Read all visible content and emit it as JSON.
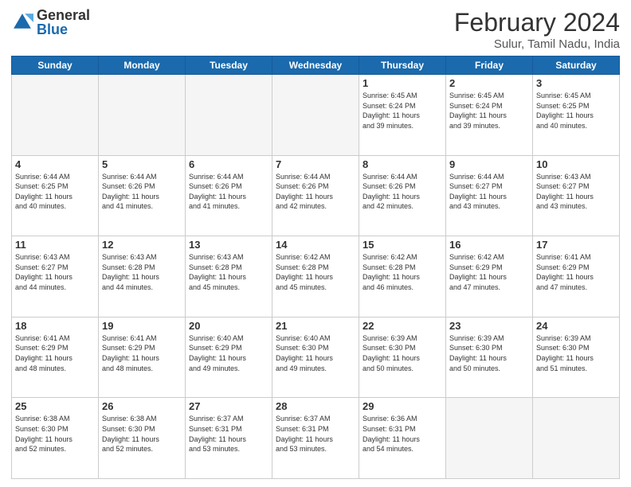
{
  "logo": {
    "general": "General",
    "blue": "Blue"
  },
  "header": {
    "month_year": "February 2024",
    "location": "Sulur, Tamil Nadu, India"
  },
  "days_of_week": [
    "Sunday",
    "Monday",
    "Tuesday",
    "Wednesday",
    "Thursday",
    "Friday",
    "Saturday"
  ],
  "weeks": [
    [
      {
        "day": "",
        "info": "",
        "empty": true
      },
      {
        "day": "",
        "info": "",
        "empty": true
      },
      {
        "day": "",
        "info": "",
        "empty": true
      },
      {
        "day": "",
        "info": "",
        "empty": true
      },
      {
        "day": "1",
        "info": "Sunrise: 6:45 AM\nSunset: 6:24 PM\nDaylight: 11 hours\nand 39 minutes.",
        "empty": false
      },
      {
        "day": "2",
        "info": "Sunrise: 6:45 AM\nSunset: 6:24 PM\nDaylight: 11 hours\nand 39 minutes.",
        "empty": false
      },
      {
        "day": "3",
        "info": "Sunrise: 6:45 AM\nSunset: 6:25 PM\nDaylight: 11 hours\nand 40 minutes.",
        "empty": false
      }
    ],
    [
      {
        "day": "4",
        "info": "Sunrise: 6:44 AM\nSunset: 6:25 PM\nDaylight: 11 hours\nand 40 minutes.",
        "empty": false
      },
      {
        "day": "5",
        "info": "Sunrise: 6:44 AM\nSunset: 6:26 PM\nDaylight: 11 hours\nand 41 minutes.",
        "empty": false
      },
      {
        "day": "6",
        "info": "Sunrise: 6:44 AM\nSunset: 6:26 PM\nDaylight: 11 hours\nand 41 minutes.",
        "empty": false
      },
      {
        "day": "7",
        "info": "Sunrise: 6:44 AM\nSunset: 6:26 PM\nDaylight: 11 hours\nand 42 minutes.",
        "empty": false
      },
      {
        "day": "8",
        "info": "Sunrise: 6:44 AM\nSunset: 6:26 PM\nDaylight: 11 hours\nand 42 minutes.",
        "empty": false
      },
      {
        "day": "9",
        "info": "Sunrise: 6:44 AM\nSunset: 6:27 PM\nDaylight: 11 hours\nand 43 minutes.",
        "empty": false
      },
      {
        "day": "10",
        "info": "Sunrise: 6:43 AM\nSunset: 6:27 PM\nDaylight: 11 hours\nand 43 minutes.",
        "empty": false
      }
    ],
    [
      {
        "day": "11",
        "info": "Sunrise: 6:43 AM\nSunset: 6:27 PM\nDaylight: 11 hours\nand 44 minutes.",
        "empty": false
      },
      {
        "day": "12",
        "info": "Sunrise: 6:43 AM\nSunset: 6:28 PM\nDaylight: 11 hours\nand 44 minutes.",
        "empty": false
      },
      {
        "day": "13",
        "info": "Sunrise: 6:43 AM\nSunset: 6:28 PM\nDaylight: 11 hours\nand 45 minutes.",
        "empty": false
      },
      {
        "day": "14",
        "info": "Sunrise: 6:42 AM\nSunset: 6:28 PM\nDaylight: 11 hours\nand 45 minutes.",
        "empty": false
      },
      {
        "day": "15",
        "info": "Sunrise: 6:42 AM\nSunset: 6:28 PM\nDaylight: 11 hours\nand 46 minutes.",
        "empty": false
      },
      {
        "day": "16",
        "info": "Sunrise: 6:42 AM\nSunset: 6:29 PM\nDaylight: 11 hours\nand 47 minutes.",
        "empty": false
      },
      {
        "day": "17",
        "info": "Sunrise: 6:41 AM\nSunset: 6:29 PM\nDaylight: 11 hours\nand 47 minutes.",
        "empty": false
      }
    ],
    [
      {
        "day": "18",
        "info": "Sunrise: 6:41 AM\nSunset: 6:29 PM\nDaylight: 11 hours\nand 48 minutes.",
        "empty": false
      },
      {
        "day": "19",
        "info": "Sunrise: 6:41 AM\nSunset: 6:29 PM\nDaylight: 11 hours\nand 48 minutes.",
        "empty": false
      },
      {
        "day": "20",
        "info": "Sunrise: 6:40 AM\nSunset: 6:29 PM\nDaylight: 11 hours\nand 49 minutes.",
        "empty": false
      },
      {
        "day": "21",
        "info": "Sunrise: 6:40 AM\nSunset: 6:30 PM\nDaylight: 11 hours\nand 49 minutes.",
        "empty": false
      },
      {
        "day": "22",
        "info": "Sunrise: 6:39 AM\nSunset: 6:30 PM\nDaylight: 11 hours\nand 50 minutes.",
        "empty": false
      },
      {
        "day": "23",
        "info": "Sunrise: 6:39 AM\nSunset: 6:30 PM\nDaylight: 11 hours\nand 50 minutes.",
        "empty": false
      },
      {
        "day": "24",
        "info": "Sunrise: 6:39 AM\nSunset: 6:30 PM\nDaylight: 11 hours\nand 51 minutes.",
        "empty": false
      }
    ],
    [
      {
        "day": "25",
        "info": "Sunrise: 6:38 AM\nSunset: 6:30 PM\nDaylight: 11 hours\nand 52 minutes.",
        "empty": false
      },
      {
        "day": "26",
        "info": "Sunrise: 6:38 AM\nSunset: 6:30 PM\nDaylight: 11 hours\nand 52 minutes.",
        "empty": false
      },
      {
        "day": "27",
        "info": "Sunrise: 6:37 AM\nSunset: 6:31 PM\nDaylight: 11 hours\nand 53 minutes.",
        "empty": false
      },
      {
        "day": "28",
        "info": "Sunrise: 6:37 AM\nSunset: 6:31 PM\nDaylight: 11 hours\nand 53 minutes.",
        "empty": false
      },
      {
        "day": "29",
        "info": "Sunrise: 6:36 AM\nSunset: 6:31 PM\nDaylight: 11 hours\nand 54 minutes.",
        "empty": false
      },
      {
        "day": "",
        "info": "",
        "empty": true
      },
      {
        "day": "",
        "info": "",
        "empty": true
      }
    ]
  ]
}
